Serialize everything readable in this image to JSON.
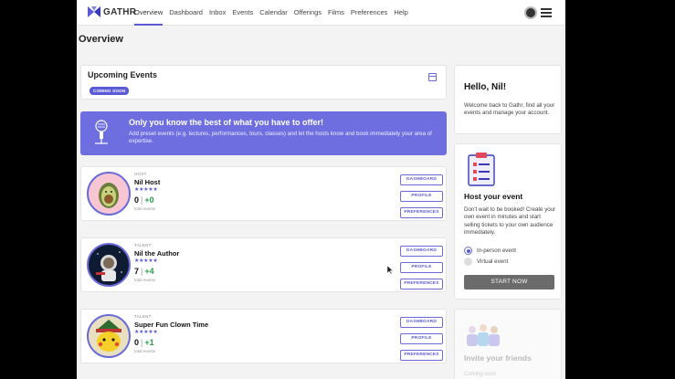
{
  "nav": {
    "logo_text": "GATHR",
    "links": [
      "Overview",
      "Dashboard",
      "Inbox",
      "Events",
      "Calendar",
      "Offerings",
      "Films",
      "Preferences",
      "Help"
    ],
    "active": "Overview"
  },
  "page": {
    "title": "Overview"
  },
  "upcoming": {
    "title": "Upcoming Events",
    "badge": "COMING SOON"
  },
  "banner": {
    "title": "Only you know the best of what you have to offer!",
    "text": "Add preset events (e.g. lectures, performances, tours, classes) and let the hosts know and book immediately your area of expertise."
  },
  "profiles": [
    {
      "type": "HOST",
      "name": "Nil Host",
      "stars": "★★★★★",
      "count": "0",
      "plus": "+0",
      "sub": "total events",
      "buttons": [
        "DASHBOARD",
        "PROFILE",
        "PREFERENCES"
      ]
    },
    {
      "type": "TALENT",
      "name": "Nil the Author",
      "stars": "★★★★★",
      "count": "7",
      "plus": "+4",
      "sub": "total events",
      "buttons": [
        "DASHBOARD",
        "PROFILE",
        "PREFERENCES"
      ]
    },
    {
      "type": "TALENT",
      "name": "Super Fun Clown Time",
      "stars": "★★★★★",
      "count": "0",
      "plus": "+1",
      "sub": "total events",
      "buttons": [
        "DASHBOARD",
        "PROFILE",
        "PREFERENCES"
      ]
    }
  ],
  "welcome": {
    "title": "Hello, Nil!",
    "text": "Welcome back to Gathr, find all your events and manage your account."
  },
  "host_event": {
    "title": "Host your event",
    "text": "Don't wait to be booked! Create your own event in minutes and start selling tickets to your own audience immediately.",
    "options": [
      "In-person event",
      "Virtual event"
    ],
    "selected": "In-person event",
    "button": "START NOW"
  },
  "invite": {
    "title": "Invite your friends",
    "sub": "Coming soon"
  },
  "colors": {
    "accent": "#5b5bd6",
    "banner": "#6e6ee0",
    "plus": "#2a9d4a"
  }
}
